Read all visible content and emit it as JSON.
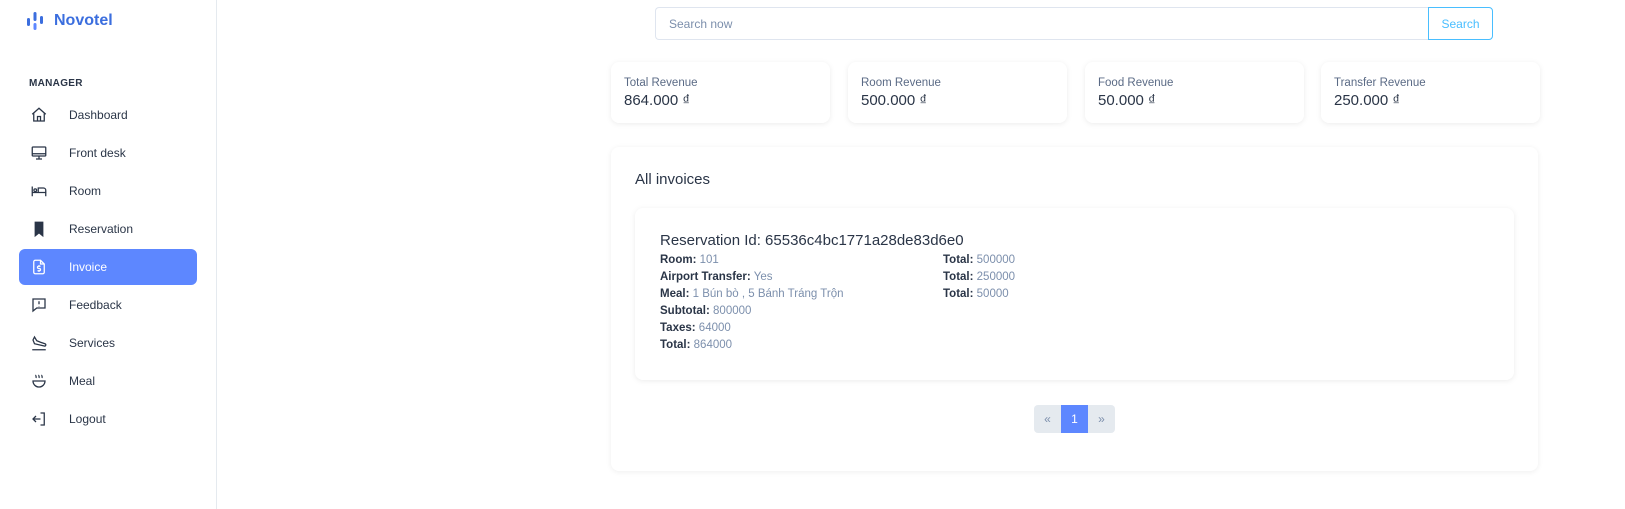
{
  "brand": {
    "name": "Novotel"
  },
  "sidebar": {
    "section_label": "MANAGER",
    "items": [
      {
        "label": "Dashboard",
        "icon": "home-icon"
      },
      {
        "label": "Front desk",
        "icon": "monitor-icon"
      },
      {
        "label": "Room",
        "icon": "bed-icon"
      },
      {
        "label": "Reservation",
        "icon": "bookmark-icon"
      },
      {
        "label": "Invoice",
        "icon": "file-dollar-icon",
        "active": true
      },
      {
        "label": "Feedback",
        "icon": "message-alert-icon"
      },
      {
        "label": "Services",
        "icon": "plane-landing-icon"
      },
      {
        "label": "Meal",
        "icon": "soup-icon"
      },
      {
        "label": "Logout",
        "icon": "logout-icon"
      }
    ]
  },
  "search": {
    "placeholder": "Search now",
    "value": "",
    "button_label": "Search"
  },
  "stats": [
    {
      "label": "Total Revenue",
      "value": "864.000 ₫"
    },
    {
      "label": "Room Revenue",
      "value": "500.000 ₫"
    },
    {
      "label": "Food Revenue",
      "value": "50.000 ₫"
    },
    {
      "label": "Transfer Revenue",
      "value": "250.000 ₫"
    }
  ],
  "invoices": {
    "title": "All invoices",
    "items": [
      {
        "heading": "Reservation Id: 65536c4bc1771a28de83d6e0",
        "left": [
          {
            "k": "Room:",
            "v": "101"
          },
          {
            "k": "Airport Transfer:",
            "v": "Yes"
          },
          {
            "k": "Meal:",
            "v": "1 Bún bò , 5 Bánh Tráng Trộn"
          },
          {
            "k": "Subtotal:",
            "v": "800000"
          },
          {
            "k": "Taxes:",
            "v": "64000"
          },
          {
            "k": "Total:",
            "v": "864000"
          }
        ],
        "right": [
          {
            "k": "Total:",
            "v": "500000"
          },
          {
            "k": "Total:",
            "v": "250000"
          },
          {
            "k": "Total:",
            "v": "50000"
          }
        ]
      }
    ]
  },
  "pagination": {
    "prev": "«",
    "current": "1",
    "next": "»"
  },
  "colors": {
    "primary": "#5d87ff",
    "accent": "#49beff",
    "brand": "#3b6ede"
  }
}
